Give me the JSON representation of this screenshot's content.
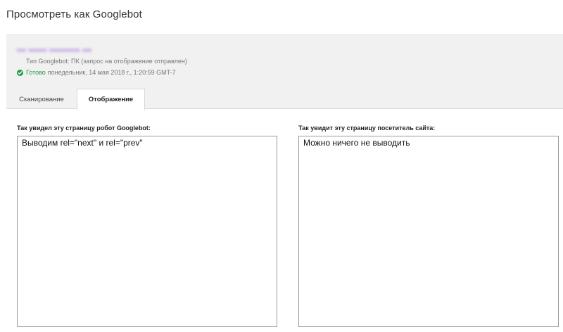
{
  "page": {
    "title": "Просмотреть как Googlebot"
  },
  "info": {
    "url_blurred": "••• •••••• •••••••••• •••",
    "bot_type": "Тип Googlebot: ПК (запрос на отображение отправлен)",
    "status_word": "Готово",
    "status_time": "понедельник, 14 мая 2018 г., 1:20:59 GMT-7",
    "status_color": "#1e9b3d",
    "status_icon": "check-circle-icon"
  },
  "tabs": [
    {
      "label": "Сканирование",
      "active": false
    },
    {
      "label": "Отображение",
      "active": true
    }
  ],
  "render": {
    "googlebot_label": "Так увидел эту страницу робот Googlebot:",
    "visitor_label": "Так увидит эту страницу посетитель сайта:",
    "googlebot_content": "Выводим rel=\"next\" и rel=\"prev\"",
    "visitor_content": "Можно ничего не выводить"
  }
}
